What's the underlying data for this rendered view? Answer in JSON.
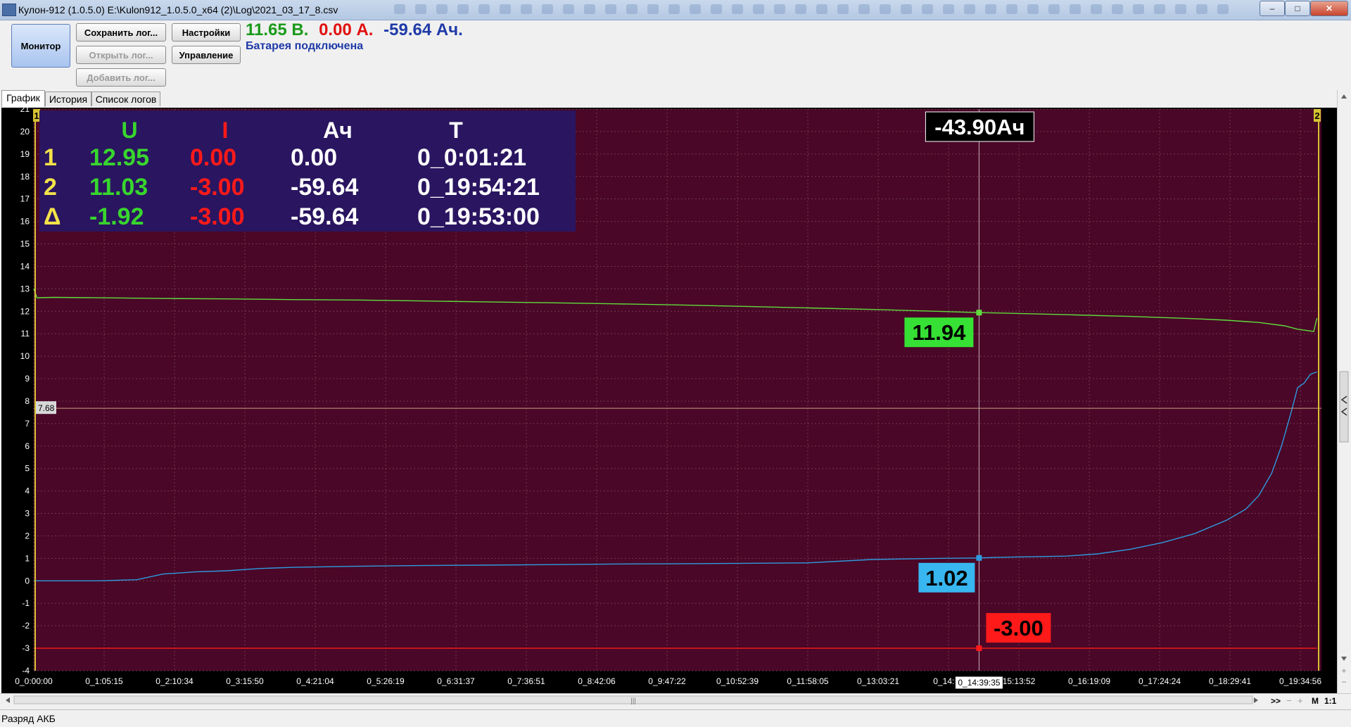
{
  "window": {
    "title": "Кулон-912 (1.0.5.0) E:\\Kulon912_1.0.5.0_x64 (2)\\Log\\2021_03_17_8.csv",
    "min": "–",
    "max": "□",
    "close": "✕"
  },
  "toolbar": {
    "monitor": "Монитор",
    "save_log": "Сохранить лог...",
    "open_log": "Открыть лог...",
    "add_log": "Добавить лог...",
    "settings": "Настройки",
    "control": "Управление"
  },
  "readout": {
    "voltage": "11.65 В.",
    "current": "0.00 А.",
    "capacity": "-59.64 Ач.",
    "status": "Батарея подключена"
  },
  "tabs": [
    "График",
    "История",
    "Список логов"
  ],
  "table": {
    "headers": [
      "U",
      "I",
      "Ач",
      "T"
    ],
    "rows": [
      {
        "label": "1",
        "u": "12.95",
        "i": "0.00",
        "ah": "0.00",
        "t": "0_0:01:21"
      },
      {
        "label": "2",
        "u": "11.03",
        "i": "-3.00",
        "ah": "-59.64",
        "t": "0_19:54:21"
      },
      {
        "label": "Δ",
        "u": "-1.92",
        "i": "-3.00",
        "ah": "-59.64",
        "t": "0_19:53:00"
      }
    ]
  },
  "cursor": {
    "ah_label": "-43.90Ач",
    "time_label": "0_14:39:35",
    "u_label": "11.94",
    "blue_label": "1.02",
    "i_label": "-3.00",
    "hline_label": "7.68",
    "marker1": "1",
    "marker2": "2"
  },
  "colors": {
    "plot_bg": "#4a0727",
    "voltage": "#5fdc3c",
    "blue": "#2e9be0",
    "current": "#ff1a1a",
    "grid": "#6f3a52",
    "marker": "#d6c233",
    "table_bg": "#2a1560"
  },
  "chart_data": {
    "type": "line",
    "ylim": [
      -4,
      21
    ],
    "yticks": [
      "21",
      "20",
      "19",
      "18",
      "17",
      "16",
      "15",
      "14",
      "13",
      "12",
      "11",
      "10",
      "9",
      "8",
      "7",
      "6",
      "5",
      "4",
      "3",
      "2",
      "1",
      "0",
      "-1",
      "-2",
      "-3",
      "-4"
    ],
    "xticks": [
      "0_0:00:00",
      "0_1:05:15",
      "0_2:10:34",
      "0_3:15:50",
      "0_4:21:04",
      "0_5:26:19",
      "0_6:31:37",
      "0_7:36:51",
      "0_8:42:06",
      "0_9:47:22",
      "0_10:52:39",
      "0_11:58:05",
      "0_13:03:21",
      "0_14:08",
      "15:13:52",
      "0_16:19:09",
      "0_17:24:24",
      "0_18:29:41",
      "0_19:34:56"
    ],
    "series": [
      {
        "color": "#5fdc3c",
        "x": [
          0,
          0.05,
          0.3,
          1,
          2,
          3,
          4,
          5,
          6,
          7,
          8,
          9,
          10,
          11,
          12,
          13,
          14,
          14.66,
          15,
          16,
          17,
          18,
          18.5,
          19,
          19.4,
          19.6,
          19.85,
          19.9
        ],
        "y": [
          13.0,
          12.6,
          12.62,
          12.6,
          12.57,
          12.55,
          12.52,
          12.5,
          12.46,
          12.42,
          12.38,
          12.33,
          12.28,
          12.22,
          12.15,
          12.08,
          12.0,
          11.94,
          11.92,
          11.85,
          11.77,
          11.67,
          11.6,
          11.5,
          11.35,
          11.2,
          11.1,
          11.7
        ]
      },
      {
        "color": "#2e9be0",
        "x": [
          0,
          1,
          1.6,
          2,
          2.5,
          3,
          3.5,
          4,
          5,
          6,
          7,
          8,
          9,
          10,
          11,
          12,
          13,
          14,
          14.66,
          15,
          16,
          16.5,
          17,
          17.5,
          18,
          18.5,
          18.8,
          19,
          19.2,
          19.35,
          19.5,
          19.6,
          19.7,
          19.8,
          19.9
        ],
        "y": [
          0,
          0,
          0.05,
          0.3,
          0.4,
          0.45,
          0.55,
          0.6,
          0.65,
          0.68,
          0.7,
          0.72,
          0.75,
          0.76,
          0.78,
          0.8,
          0.95,
          1.0,
          1.02,
          1.05,
          1.1,
          1.2,
          1.4,
          1.7,
          2.1,
          2.7,
          3.2,
          3.8,
          4.8,
          6.0,
          7.5,
          8.6,
          8.8,
          9.2,
          9.3
        ]
      },
      {
        "color": "#ff1a1a",
        "x": [
          0,
          19.9
        ],
        "y": [
          -3.0,
          -3.0
        ]
      }
    ],
    "cursor_time": 14.66,
    "hline_value": 7.68,
    "x_max": 19.97
  }
}
